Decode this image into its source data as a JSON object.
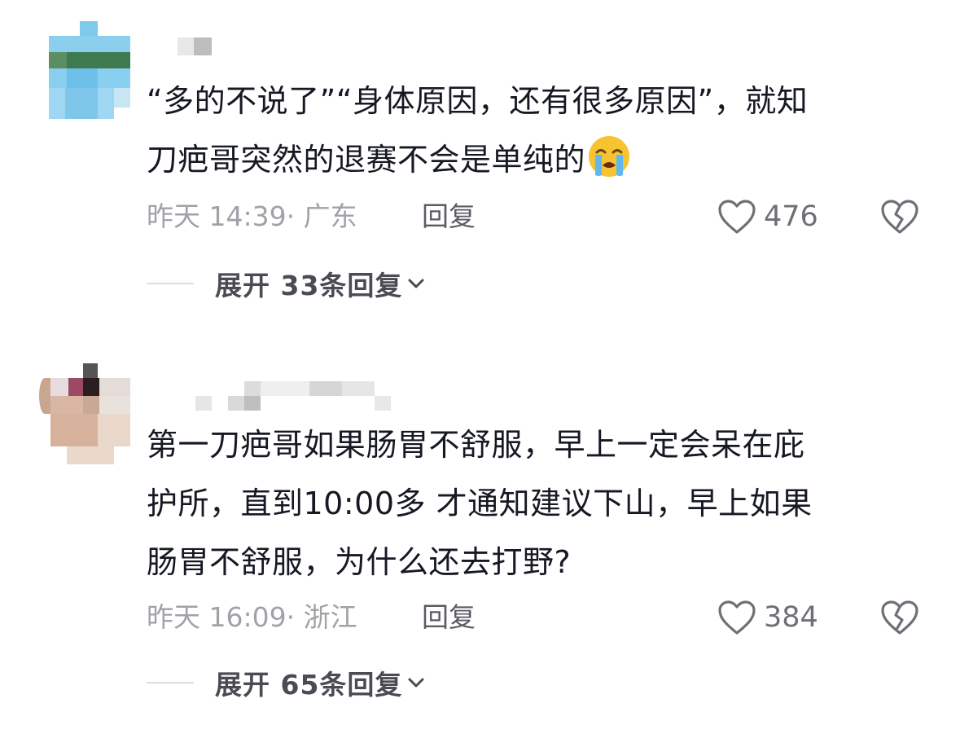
{
  "comments": [
    {
      "text_line_1": "“多的不说了”“身体原因，还有很多原因”，就知",
      "text_line_2": "刀疤哥突然的退赛不会是单纯的",
      "emoji": "loudly-crying-face-icon",
      "time_location": "昨天 14:39· 广东",
      "reply_label": "回复",
      "like_count": "476",
      "expand_label": "展开 33条回复"
    },
    {
      "text_line_1": "第一刀疤哥如果肠胃不舒服，早上一定会呆在庇",
      "text_line_2": "护所，直到10:00多 才通知建议下山，早上如果",
      "text_line_3": "肠胃不舒服，为什么还去打野?",
      "time_location": "昨天 16:09· 浙江",
      "reply_label": "回复",
      "like_count": "384",
      "expand_label": "展开 65条回复"
    }
  ],
  "colors": {
    "body_text": "#161823",
    "meta_text": "#a1a2a7",
    "reply_text": "#5a5b63",
    "expand_text": "#4a4b53",
    "icon_stroke": "#6f7077"
  }
}
